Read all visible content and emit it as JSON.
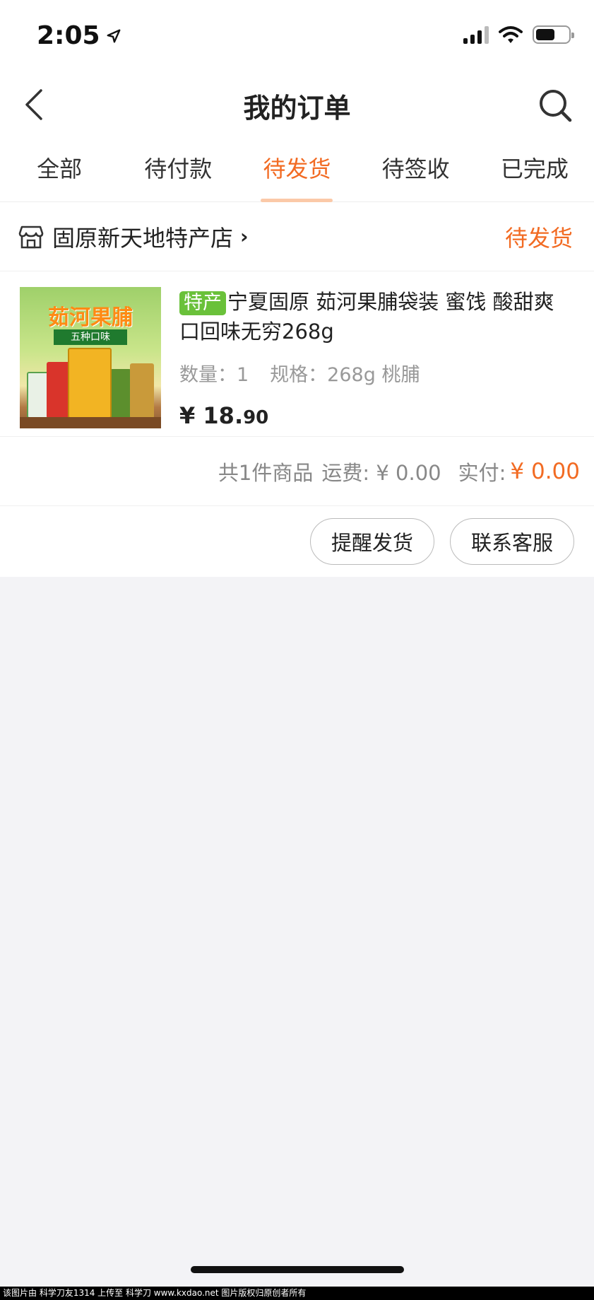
{
  "status_bar": {
    "time": "2:05"
  },
  "nav": {
    "title": "我的订单"
  },
  "tabs": [
    {
      "label": "全部"
    },
    {
      "label": "待付款"
    },
    {
      "label": "待发货"
    },
    {
      "label": "待签收"
    },
    {
      "label": "已完成"
    }
  ],
  "active_tab_index": 2,
  "order": {
    "shop_name": "固原新天地特产店",
    "shop_chevron": "›",
    "status": "待发货",
    "product": {
      "image_title": "茹河果脯",
      "image_subtitle": "五种口味",
      "tag": "特产",
      "title": "宁夏固原 茹河果脯袋装 蜜饯 酸甜爽口回味无穷268g",
      "quantity": "数量：1",
      "spec": "规格：268g 桃脯",
      "price_main": "¥ 18.",
      "price_cents": "90"
    },
    "summary": {
      "count_text": "共1件商品",
      "shipping_text": "运费: ¥ 0.00",
      "paid_label": "实付:",
      "paid_value": "¥ 0.00"
    },
    "actions": {
      "remind_label": "提醒发货",
      "contact_label": "联系客服"
    }
  },
  "watermark": "该图片由 科学刀友1314 上传至 科学刀 www.kxdao.net 图片版权归原创者所有",
  "colors": {
    "accent": "#f26b23",
    "tag_green": "#6ac13a",
    "tab_underline": "#fbc9a8"
  }
}
